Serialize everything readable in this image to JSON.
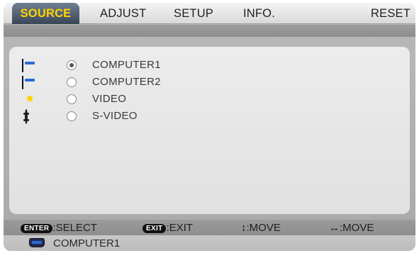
{
  "tabs": [
    "SOURCE",
    "ADJUST",
    "SETUP",
    "INFO.",
    "RESET"
  ],
  "sources": [
    {
      "label": "COMPUTER1",
      "icon": "vga-connector-icon",
      "selected": true
    },
    {
      "label": "COMPUTER2",
      "icon": "vga-connector-icon",
      "selected": false
    },
    {
      "label": "VIDEO",
      "icon": "rca-video-icon",
      "selected": false
    },
    {
      "label": "S-VIDEO",
      "icon": "s-video-icon",
      "selected": false
    }
  ],
  "footer": {
    "enter_key": "ENTER",
    "enter_action": ":SELECT",
    "exit_key": "EXIT",
    "exit_action": ":EXIT",
    "updown_glyph": "↕",
    "updown_action": ":MOVE",
    "leftright_glyph": "↔",
    "leftright_action": ":MOVE"
  },
  "status": {
    "current_source": "COMPUTER1",
    "icon": "vga-connector-icon"
  },
  "colors": {
    "active_tab_text": "#ffd400",
    "active_tab_bg": "#4d5a6b"
  }
}
